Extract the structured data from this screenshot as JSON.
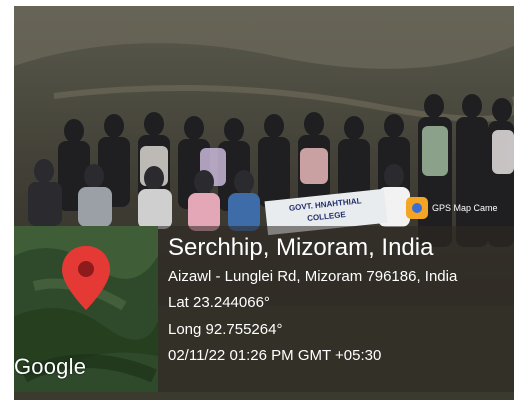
{
  "overlay": {
    "place_title": "Serchhip, Mizoram, India",
    "address": "Aizawl - Lunglei Rd, Mizoram 796186, India",
    "latitude": "Lat 23.244066°",
    "longitude": "Long 92.755264°",
    "datetime": "02/11/22 01:26 PM GMT +05:30",
    "map_provider": "Google",
    "app_badge": "GPS Map Came"
  },
  "banner": {
    "line1": "GOVT. HNAHTHIAL",
    "line2": "COLLEGE"
  },
  "colors": {
    "pin": "#e53935",
    "panel": "#2d2823"
  },
  "icons": {
    "map_pin": "map-pin-icon",
    "app": "gps-map-camera-icon"
  }
}
